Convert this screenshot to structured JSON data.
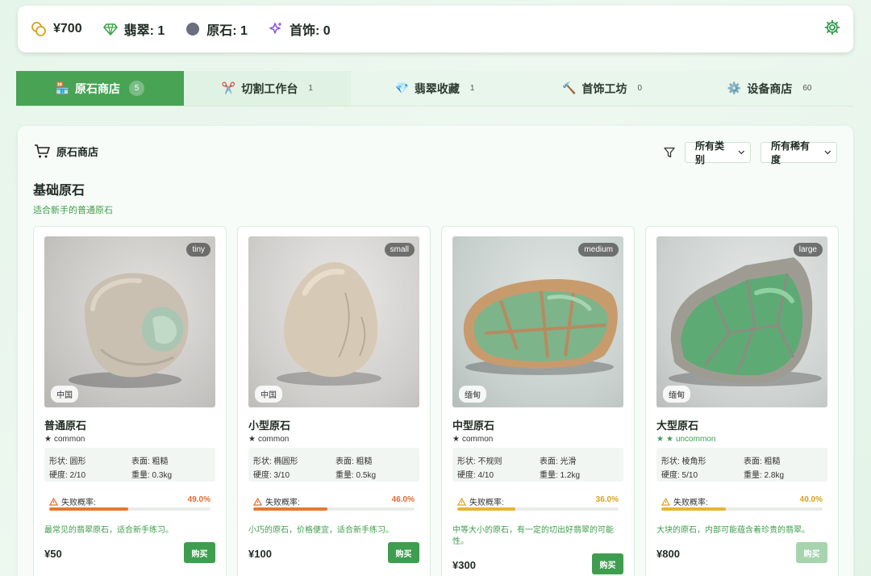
{
  "stats": {
    "money": "¥700",
    "jade": "翡翠: 1",
    "rough": "原石: 1",
    "jewelry": "首饰: 0"
  },
  "tabs": [
    {
      "label": "原石商店",
      "count": "5",
      "icon": "store-icon"
    },
    {
      "label": "切割工作台",
      "count": "1",
      "icon": "scissors-icon"
    },
    {
      "label": "翡翠收藏",
      "count": "1",
      "icon": "gem-icon"
    },
    {
      "label": "首饰工坊",
      "count": "0",
      "icon": "hammer-icon"
    },
    {
      "label": "设备商店",
      "count": "60",
      "icon": "gear-icon"
    }
  ],
  "panel": {
    "title": "原石商店",
    "filter_category": "所有类别",
    "filter_rarity": "所有稀有度",
    "section_title": "基础原石",
    "section_subtitle": "适合新手的普通原石"
  },
  "labels": {
    "fail_rate": "失败概率:",
    "buy": "购买"
  },
  "colors": {
    "accent": "#48a355",
    "fail_high": "#e07a35",
    "fail_mid": "#e8b33a",
    "uncommon": "#3f9d4f"
  },
  "cards": [
    {
      "name": "普通原石",
      "size": "tiny",
      "origin": "中国",
      "rarity": "common",
      "stars": 1,
      "shape": "形状: 圆形",
      "surface": "表面: 粗糙",
      "hardness": "硬度: 2/10",
      "weight": "重量: 0.3kg",
      "fail_pct": "49.0%",
      "fail_value": 0.49,
      "desc": "最常见的翡翠原石，适合新手练习。",
      "price": "¥50",
      "buy_enabled": true
    },
    {
      "name": "小型原石",
      "size": "small",
      "origin": "中国",
      "rarity": "common",
      "stars": 1,
      "shape": "形状: 椭圆形",
      "surface": "表面: 粗糙",
      "hardness": "硬度: 3/10",
      "weight": "重量: 0.5kg",
      "fail_pct": "46.0%",
      "fail_value": 0.46,
      "desc": "小巧的原石，价格便宜，适合新手练习。",
      "price": "¥100",
      "buy_enabled": true
    },
    {
      "name": "中型原石",
      "size": "medium",
      "origin": "缅甸",
      "rarity": "common",
      "stars": 1,
      "shape": "形状: 不规则",
      "surface": "表面: 光滑",
      "hardness": "硬度: 4/10",
      "weight": "重量: 1.2kg",
      "fail_pct": "36.0%",
      "fail_value": 0.36,
      "desc": "中等大小的原石，有一定的切出好翡翠的可能性。",
      "price": "¥300",
      "buy_enabled": true
    },
    {
      "name": "大型原石",
      "size": "large",
      "origin": "缅甸",
      "rarity": "uncommon",
      "stars": 2,
      "shape": "形状: 棱角形",
      "surface": "表面: 粗糙",
      "hardness": "硬度: 5/10",
      "weight": "重量: 2.8kg",
      "fail_pct": "40.0%",
      "fail_value": 0.4,
      "desc": "大块的原石，内部可能蕴含着珍贵的翡翠。",
      "price": "¥800",
      "buy_enabled": false
    }
  ]
}
